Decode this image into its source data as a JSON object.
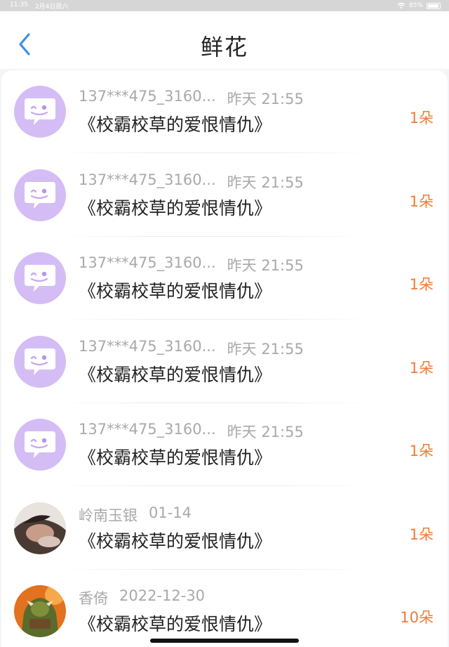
{
  "status_bar": {
    "time": "11:35",
    "date": "2月4日周六",
    "battery": "85%"
  },
  "header": {
    "title": "鲜花"
  },
  "records": [
    {
      "user": "137***475_3160...",
      "time": "昨天 21:55",
      "book": "《校霸校草的爱恨情仇》",
      "count": "1朵",
      "avatar": "default"
    },
    {
      "user": "137***475_3160...",
      "time": "昨天 21:55",
      "book": "《校霸校草的爱恨情仇》",
      "count": "1朵",
      "avatar": "default"
    },
    {
      "user": "137***475_3160...",
      "time": "昨天 21:55",
      "book": "《校霸校草的爱恨情仇》",
      "count": "1朵",
      "avatar": "default"
    },
    {
      "user": "137***475_3160...",
      "time": "昨天 21:55",
      "book": "《校霸校草的爱恨情仇》",
      "count": "1朵",
      "avatar": "default"
    },
    {
      "user": "137***475_3160...",
      "time": "昨天 21:55",
      "book": "《校霸校草的爱恨情仇》",
      "count": "1朵",
      "avatar": "default"
    },
    {
      "user": "岭南玉银",
      "time": "01-14",
      "book": "《校霸校草的爱恨情仇》",
      "count": "1朵",
      "avatar": "photo"
    },
    {
      "user": "香倚",
      "time": "2022-12-30",
      "book": "《校霸校草的爱恨情仇》",
      "count": "10朵",
      "avatar": "game"
    }
  ],
  "colors": {
    "accent": "#f07b38",
    "back_arrow": "#3d8fe0",
    "avatar_bg": "#d4bdf5"
  }
}
